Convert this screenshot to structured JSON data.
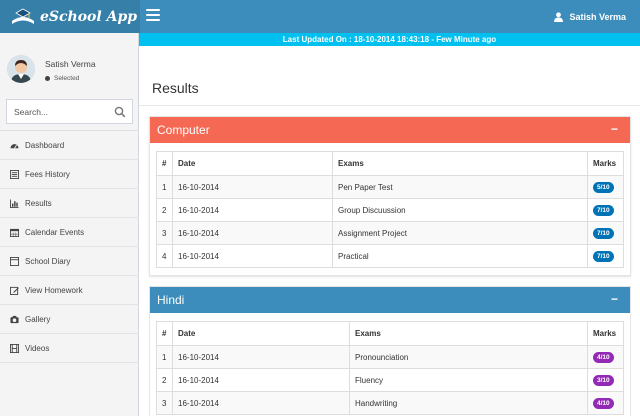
{
  "app": {
    "brand": "eSchool App",
    "user": "Satish Verma"
  },
  "colors": {
    "topbar": "#3c8dbc",
    "brand_bg": "#367fa9",
    "notice_bg": "#00c0ef",
    "computer_header": "#f56954",
    "hindi_header": "#3c8dbc",
    "badge_blue": "#0073b7",
    "badge_purple": "#932ab6"
  },
  "notice": "Last Updated On : 18-10-2014 18:43:18 - Few Minute ago",
  "sidebar": {
    "user_name": "Satish Verma",
    "user_status": "Selected",
    "search_placeholder": "Search...",
    "items": [
      {
        "label": "Dashboard",
        "icon": "dashboard-icon"
      },
      {
        "label": "Fees History",
        "icon": "list-icon"
      },
      {
        "label": "Results",
        "icon": "bar-chart-icon"
      },
      {
        "label": "Calendar Events",
        "icon": "calendar-icon"
      },
      {
        "label": "School Diary",
        "icon": "book-icon"
      },
      {
        "label": "View Homework",
        "icon": "edit-icon"
      },
      {
        "label": "Gallery",
        "icon": "camera-icon"
      },
      {
        "label": "Videos",
        "icon": "film-icon"
      }
    ]
  },
  "page": {
    "title": "Results"
  },
  "results": [
    {
      "subject": "Computer",
      "collapse": "−",
      "columns": [
        "#",
        "Date",
        "Exams",
        "Marks"
      ],
      "rows": [
        {
          "n": "1",
          "date": "16-10-2014",
          "exam": "Pen Paper Test",
          "marks": "5/10"
        },
        {
          "n": "2",
          "date": "16-10-2014",
          "exam": "Group Discuussion",
          "marks": "7/10"
        },
        {
          "n": "3",
          "date": "16-10-2014",
          "exam": "Assignment Project",
          "marks": "7/10"
        },
        {
          "n": "4",
          "date": "16-10-2014",
          "exam": "Practical",
          "marks": "7/10"
        }
      ]
    },
    {
      "subject": "Hindi",
      "collapse": "−",
      "columns": [
        "#",
        "Date",
        "Exams",
        "Marks"
      ],
      "rows": [
        {
          "n": "1",
          "date": "16-10-2014",
          "exam": "Pronounciation",
          "marks": "4/10"
        },
        {
          "n": "2",
          "date": "16-10-2014",
          "exam": "Fluency",
          "marks": "3/10"
        },
        {
          "n": "3",
          "date": "16-10-2014",
          "exam": "Handwriting",
          "marks": "4/10"
        }
      ]
    }
  ]
}
